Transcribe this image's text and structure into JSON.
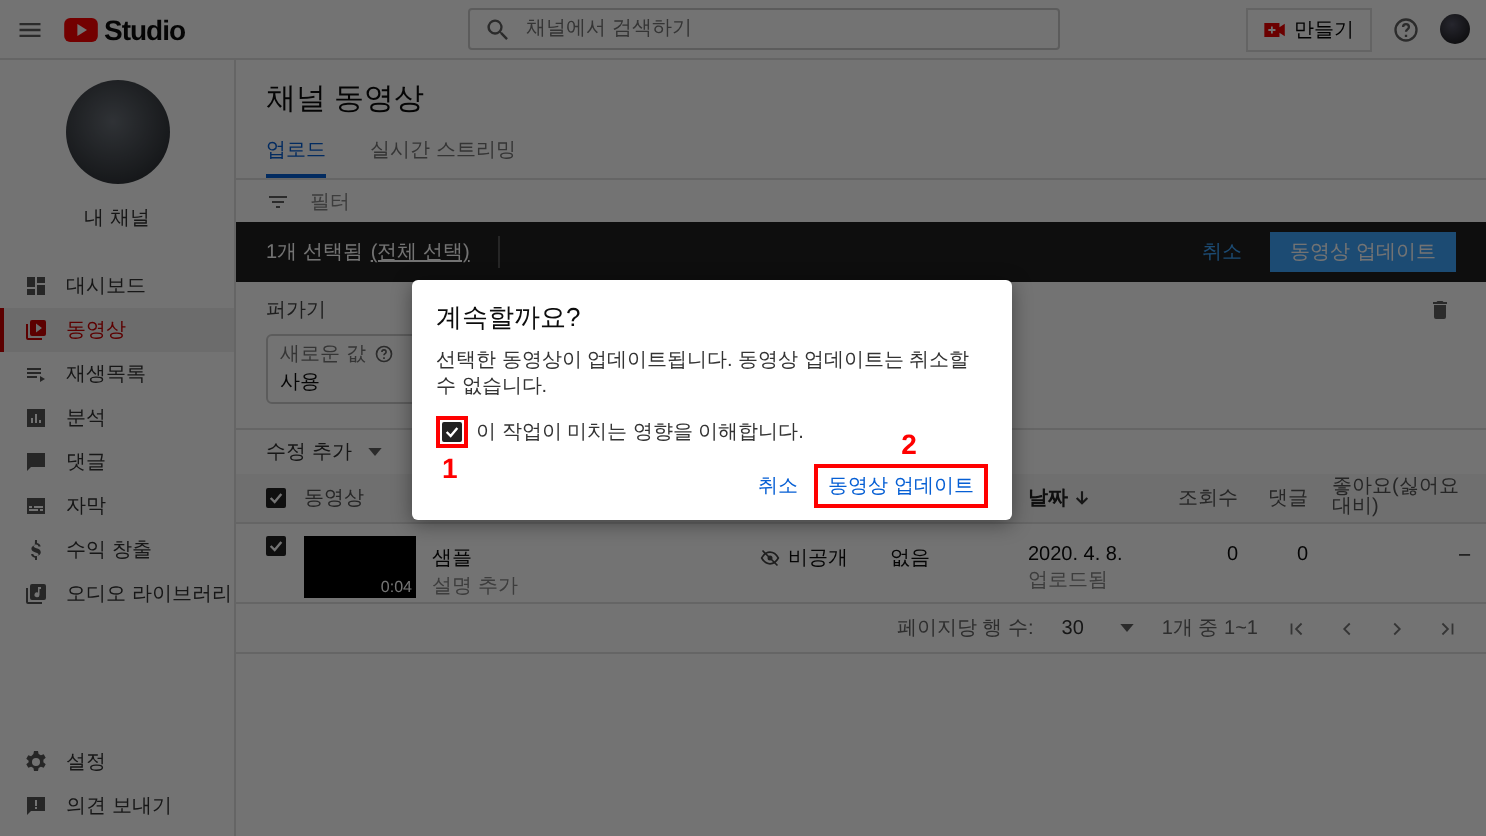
{
  "header": {
    "logo": "Studio",
    "search": {
      "placeholder": "채널에서 검색하기"
    },
    "create_button": "만들기"
  },
  "sidebar": {
    "channel_name": "내 채널",
    "items": [
      {
        "label": "대시보드",
        "selected": false
      },
      {
        "label": "동영상",
        "selected": true
      },
      {
        "label": "재생목록",
        "selected": false
      },
      {
        "label": "분석",
        "selected": false
      },
      {
        "label": "댓글",
        "selected": false
      },
      {
        "label": "자막",
        "selected": false
      },
      {
        "label": "수익 창출",
        "selected": false
      },
      {
        "label": "오디오 라이브러리",
        "selected": false
      }
    ],
    "footer_items": [
      {
        "label": "설정"
      },
      {
        "label": "의견 보내기"
      }
    ]
  },
  "page": {
    "title": "채널 동영상",
    "tabs": [
      {
        "label": "업로드",
        "selected": true
      },
      {
        "label": "실시간 스트리밍",
        "selected": false
      }
    ],
    "filter": "필터"
  },
  "selection_bar": {
    "count": "1개 선택됨",
    "select_all": "(전체 선택)",
    "cancel": "취소",
    "update": "동영상 업데이트"
  },
  "edit_panel": {
    "label": "퍼가기",
    "field": {
      "label": "새로운 값",
      "value": "사용"
    },
    "add_edit": "수정 추가"
  },
  "table": {
    "header_checked": true,
    "columns": [
      {
        "label": "동영상",
        "sorted": false
      },
      {
        "label": "날짜",
        "sorted": true
      },
      {
        "label": "조회수",
        "sorted": false
      },
      {
        "label": "댓글",
        "sorted": false
      },
      {
        "label": "좋아요(싫어요 대비)",
        "sorted": false
      }
    ],
    "rows": [
      {
        "checked": true,
        "duration": "0:04",
        "title": "샘플",
        "description": "설명 추가",
        "visibility": "비공개",
        "restrictions": "없음",
        "date": "2020. 4. 8.",
        "date_status": "업로드됨",
        "views": "0",
        "comments": "0",
        "likes": "–"
      }
    ]
  },
  "pagination": {
    "rows_label": "페이지당 행 수:",
    "rows_value": "30",
    "range": "1개 중 1~1"
  },
  "dialog": {
    "title": "계속할까요?",
    "message": "선택한 동영상이 업데이트됩니다. 동영상 업데이트는 취소할 수 없습니다.",
    "confirm": {
      "label": "이 작업이 미치는 영향을 이해합니다.",
      "checked": true,
      "annotation": "1"
    },
    "cancel": "취소",
    "update": {
      "label": "동영상 업데이트",
      "annotation": "2"
    }
  }
}
